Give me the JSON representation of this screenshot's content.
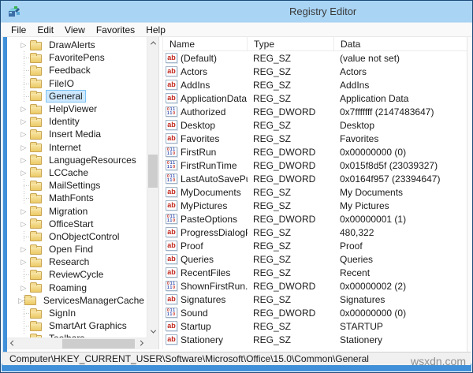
{
  "titlebar": {
    "title": "Registry Editor",
    "icon": "registry-editor"
  },
  "menu": {
    "items": [
      "File",
      "Edit",
      "View",
      "Favorites",
      "Help"
    ]
  },
  "tree": {
    "items": [
      {
        "label": "DrawAlerts",
        "expandable": true,
        "selected": false
      },
      {
        "label": "FavoritePens",
        "expandable": false,
        "selected": false
      },
      {
        "label": "Feedback",
        "expandable": false,
        "selected": false
      },
      {
        "label": "FileIO",
        "expandable": false,
        "selected": false
      },
      {
        "label": "General",
        "expandable": false,
        "selected": true
      },
      {
        "label": "HelpViewer",
        "expandable": true,
        "selected": false
      },
      {
        "label": "Identity",
        "expandable": true,
        "selected": false
      },
      {
        "label": "Insert Media",
        "expandable": true,
        "selected": false
      },
      {
        "label": "Internet",
        "expandable": true,
        "selected": false
      },
      {
        "label": "LanguageResources",
        "expandable": true,
        "selected": false
      },
      {
        "label": "LCCache",
        "expandable": true,
        "selected": false
      },
      {
        "label": "MailSettings",
        "expandable": false,
        "selected": false
      },
      {
        "label": "MathFonts",
        "expandable": false,
        "selected": false
      },
      {
        "label": "Migration",
        "expandable": true,
        "selected": false
      },
      {
        "label": "OfficeStart",
        "expandable": true,
        "selected": false
      },
      {
        "label": "OnObjectControl",
        "expandable": false,
        "selected": false
      },
      {
        "label": "Open Find",
        "expandable": true,
        "selected": false
      },
      {
        "label": "Research",
        "expandable": true,
        "selected": false
      },
      {
        "label": "ReviewCycle",
        "expandable": false,
        "selected": false
      },
      {
        "label": "Roaming",
        "expandable": true,
        "selected": false
      },
      {
        "label": "ServicesManagerCache",
        "expandable": true,
        "selected": false
      },
      {
        "label": "SignIn",
        "expandable": false,
        "selected": false
      },
      {
        "label": "SmartArt Graphics",
        "expandable": false,
        "selected": false
      },
      {
        "label": "Toolbars",
        "expandable": false,
        "selected": false
      }
    ]
  },
  "list": {
    "columns": [
      "Name",
      "Type",
      "Data"
    ],
    "rows": [
      {
        "name": "(Default)",
        "type": "REG_SZ",
        "data": "(value not set)",
        "icon": "sz"
      },
      {
        "name": "Actors",
        "type": "REG_SZ",
        "data": "Actors",
        "icon": "sz"
      },
      {
        "name": "AddIns",
        "type": "REG_SZ",
        "data": "AddIns",
        "icon": "sz"
      },
      {
        "name": "ApplicationData",
        "type": "REG_SZ",
        "data": "Application Data",
        "icon": "sz"
      },
      {
        "name": "Authorized",
        "type": "REG_DWORD",
        "data": "0x7fffffff (2147483647)",
        "icon": "dword"
      },
      {
        "name": "Desktop",
        "type": "REG_SZ",
        "data": "Desktop",
        "icon": "sz"
      },
      {
        "name": "Favorites",
        "type": "REG_SZ",
        "data": "Favorites",
        "icon": "sz"
      },
      {
        "name": "FirstRun",
        "type": "REG_DWORD",
        "data": "0x00000000 (0)",
        "icon": "dword"
      },
      {
        "name": "FirstRunTime",
        "type": "REG_DWORD",
        "data": "0x015f8d5f (23039327)",
        "icon": "dword"
      },
      {
        "name": "LastAutoSavePu...",
        "type": "REG_DWORD",
        "data": "0x0164f957 (23394647)",
        "icon": "dword"
      },
      {
        "name": "MyDocuments",
        "type": "REG_SZ",
        "data": "My Documents",
        "icon": "sz"
      },
      {
        "name": "MyPictures",
        "type": "REG_SZ",
        "data": "My Pictures",
        "icon": "sz"
      },
      {
        "name": "PasteOptions",
        "type": "REG_DWORD",
        "data": "0x00000001 (1)",
        "icon": "dword"
      },
      {
        "name": "ProgressDialogP...",
        "type": "REG_SZ",
        "data": "480,322",
        "icon": "sz"
      },
      {
        "name": "Proof",
        "type": "REG_SZ",
        "data": "Proof",
        "icon": "sz"
      },
      {
        "name": "Queries",
        "type": "REG_SZ",
        "data": "Queries",
        "icon": "sz"
      },
      {
        "name": "RecentFiles",
        "type": "REG_SZ",
        "data": "Recent",
        "icon": "sz"
      },
      {
        "name": "ShownFirstRun...",
        "type": "REG_DWORD",
        "data": "0x00000002 (2)",
        "icon": "dword"
      },
      {
        "name": "Signatures",
        "type": "REG_SZ",
        "data": "Signatures",
        "icon": "sz"
      },
      {
        "name": "Sound",
        "type": "REG_DWORD",
        "data": "0x00000000 (0)",
        "icon": "dword"
      },
      {
        "name": "Startup",
        "type": "REG_SZ",
        "data": "STARTUP",
        "icon": "sz"
      },
      {
        "name": "Stationery",
        "type": "REG_SZ",
        "data": "Stationery",
        "icon": "sz"
      }
    ]
  },
  "status": {
    "path": "Computer\\HKEY_CURRENT_USER\\Software\\Microsoft\\Office\\15.0\\Common\\General"
  },
  "watermark": "wsxdn.com",
  "colors": {
    "titlebar": "#a9d4f4",
    "frame": "#4090d9",
    "selection_bg": "#cde8ff",
    "selection_border": "#7cc3f2",
    "reg_sz_icon": "#c2281e",
    "reg_dword_icon": "#2a43a8"
  }
}
